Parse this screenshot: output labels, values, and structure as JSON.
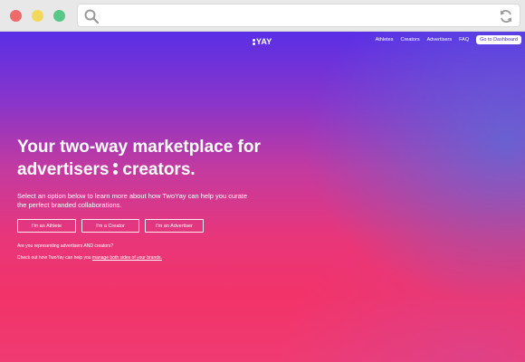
{
  "nav": {
    "logo_text": "YAY",
    "links": [
      "Athletes",
      "Creators",
      "Advertisers",
      "FAQ"
    ],
    "dashboard_button": "Go to Dashboard"
  },
  "hero": {
    "title_line1": "Your two-way marketplace for",
    "title_line2_a": "advertisers",
    "title_line2_b": "creators.",
    "subtitle": "Select an option below to learn more about how TwoYay can help you curate the perfect branded collaborations.",
    "buttons": [
      "I'm an Athlete",
      "I'm a Creator",
      "I'm an Advertiser"
    ],
    "note_question": "Are you representing advertisers AND creators?",
    "note_prefix": "Check out how TwoYay can help you ",
    "note_link": "manage both sides of your brands."
  },
  "colors": {
    "gradient_top": "#5a2fe6",
    "gradient_bottom": "#ef3b72",
    "dashboard_text": "#4a2dc9"
  },
  "icons": [
    "search-icon",
    "reload-icon"
  ]
}
